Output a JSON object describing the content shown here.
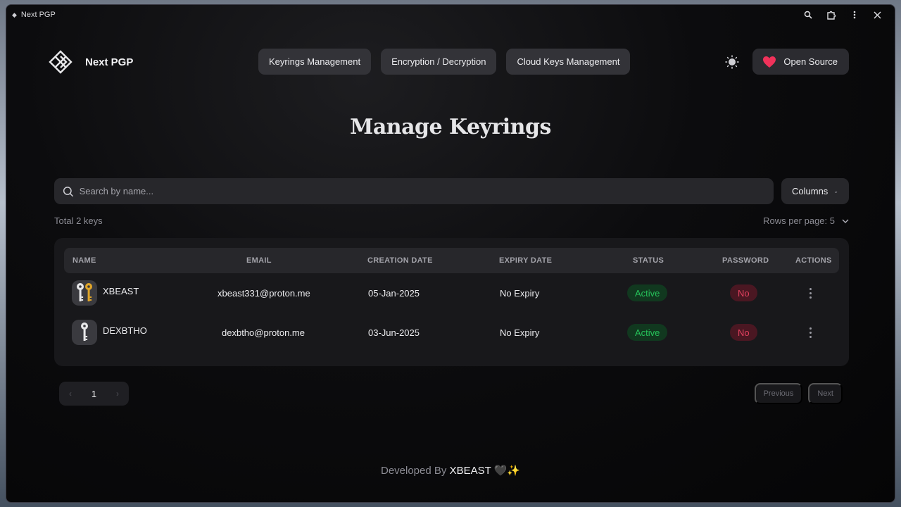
{
  "window": {
    "title": "Next PGP",
    "controls": [
      "zoom-icon",
      "extension-icon",
      "more-vert-icon",
      "close-icon"
    ]
  },
  "nav": {
    "brand": "Next PGP",
    "links": [
      "Keyrings Management",
      "Encryption / Decryption",
      "Cloud Keys Management"
    ],
    "open_source_label": "Open Source"
  },
  "page": {
    "title": "Manage Keyrings"
  },
  "toolbar": {
    "search_placeholder": "Search by name...",
    "columns_label": "Columns",
    "total_label": "Total 2 keys",
    "rows_per_page_label": "Rows per page: 5"
  },
  "table": {
    "headers": [
      "NAME",
      "EMAIL",
      "CREATION DATE",
      "EXPIRY DATE",
      "STATUS",
      "PASSWORD",
      "ACTIONS"
    ],
    "rows": [
      {
        "name": "XBEAST",
        "email": "xbeast331@proton.me",
        "created": "05-Jan-2025",
        "expiry": "No Expiry",
        "status": "Active",
        "password": "No",
        "avatar": "two-keys-icon"
      },
      {
        "name": "DEXBTHO",
        "email": "dexbtho@proton.me",
        "created": "03-Jun-2025",
        "expiry": "No Expiry",
        "status": "Active",
        "password": "No",
        "avatar": "single-key-icon"
      }
    ]
  },
  "pagination": {
    "current_page": "1",
    "previous_label": "Previous",
    "next_label": "Next"
  },
  "footer": {
    "prefix": "Developed By",
    "author": "XBEAST",
    "suffix": "🖤✨"
  },
  "colors": {
    "status_active": "#26c25a",
    "password_no": "#e0415f",
    "heart": "#f0325a"
  }
}
